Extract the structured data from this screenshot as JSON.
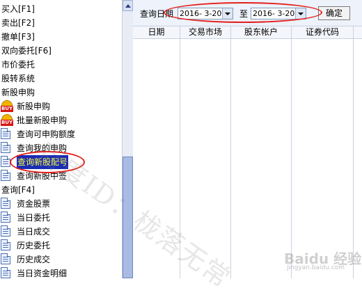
{
  "tree": {
    "items": [
      {
        "label": "买入[F1]",
        "kind": "top"
      },
      {
        "label": "卖出[F2]",
        "kind": "top"
      },
      {
        "label": "撤单[F3]",
        "kind": "top"
      },
      {
        "label": "双向委托[F6]",
        "kind": "top"
      },
      {
        "label": "市价委托",
        "kind": "top"
      },
      {
        "label": "股转系统",
        "kind": "top"
      },
      {
        "label": "新股申购",
        "kind": "top"
      },
      {
        "label": "新股申购",
        "kind": "child",
        "icon": "buy-icon"
      },
      {
        "label": "批量新股申购",
        "kind": "child",
        "icon": "buy-icon"
      },
      {
        "label": "查询可申购额度",
        "kind": "child",
        "icon": "document-icon"
      },
      {
        "label": "查询我的申购",
        "kind": "child",
        "icon": "document-icon"
      },
      {
        "label": "查询新股配号",
        "kind": "child",
        "icon": "document-icon",
        "selected": true
      },
      {
        "label": "查询新股中签",
        "kind": "child",
        "icon": "document-icon"
      },
      {
        "label": "查询[F4]",
        "kind": "top"
      },
      {
        "label": "资金股票",
        "kind": "child",
        "icon": "document-icon"
      },
      {
        "label": "当日委托",
        "kind": "child",
        "icon": "document-icon"
      },
      {
        "label": "当日成交",
        "kind": "child",
        "icon": "document-icon"
      },
      {
        "label": "历史委托",
        "kind": "child",
        "icon": "document-icon"
      },
      {
        "label": "历史成交",
        "kind": "child",
        "icon": "document-icon"
      },
      {
        "label": "当日资金明细",
        "kind": "child",
        "icon": "document-icon"
      }
    ]
  },
  "query": {
    "date_label": "查询日期",
    "date_from": "2016- 3-20",
    "to_label": "至",
    "date_to": "2016- 3-20",
    "confirm_label": "确定"
  },
  "table": {
    "columns": [
      "日期",
      "交易市场",
      "股东帐户",
      "证券代码"
    ]
  },
  "watermark": {
    "text": "百度ID：栊落无常",
    "brand": "Baidu 经验",
    "brand_sub": "jingyan.baidu.com"
  },
  "colors": {
    "selection_bg": "#1a2bb5",
    "selection_fg": "#ffff3a",
    "annotation": "#e3201b"
  }
}
